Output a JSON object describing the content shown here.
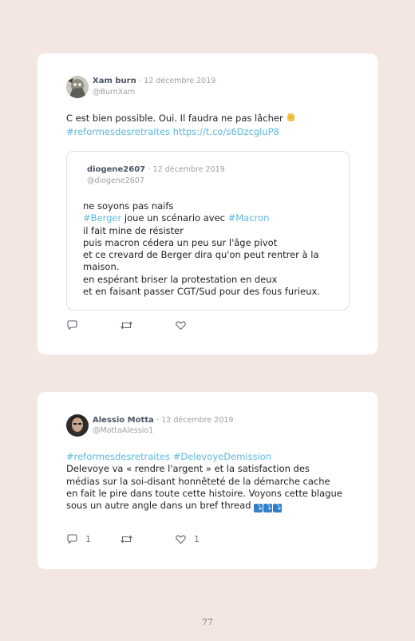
{
  "page": {
    "number": "77"
  },
  "tweets": [
    {
      "author_name": "Xam burn",
      "date": "· 12 décembre 2019",
      "handle": "@BurnXam",
      "text_line1": "C est bien possible. Oui. Il faudra ne pas lâcher",
      "emoji": "raised-fist-icon",
      "hashtag": "#reformesdesretraites",
      "link": "https://t.co/s6DzcgluP8",
      "quoted": {
        "author_name": "diogene2607",
        "date": "· 12 décembre 2019",
        "handle": "@diogene2607",
        "line1": "ne soyons pas naifs",
        "line2_hashtag1": "#Berger",
        "line2_middle": " joue un scénario avec ",
        "line2_hashtag2": "#Macron",
        "line3": "il fait mine de résister",
        "line4": "puis macron cédera un peu sur l'âge pivot",
        "line5": "et ce crevard de Berger dira qu'on peut rentrer à la",
        "line6": "maison.",
        "line7": "en espérant briser la protestation en deux",
        "line8": "et en faisant passer CGT/Sud pour des fous furieux."
      },
      "actions": {
        "reply_count": "",
        "retweet_count": "",
        "like_count": ""
      }
    },
    {
      "author_name": "Alessio Motta",
      "date": "· 12 décembre 2019",
      "handle": "@MottaAlessio1",
      "hashtag1": "#reformesdesretraites",
      "hashtag2": "#DelevoyeDemission",
      "line2": "Delevoye va « rendre l'argent » et la satisfaction des",
      "line3": "médias sur la soi-disant honnêteté de la démarche cache",
      "line4": "en fait le pire dans toute cette histoire. Voyons cette blague",
      "line5": "sous un autre angle dans un bref thread",
      "emoji": "arrow-down-emoji-icon",
      "actions": {
        "reply_count": "1",
        "retweet_count": "",
        "like_count": "1"
      }
    }
  ],
  "colors": {
    "background": "#f4e7e3",
    "card": "#ffffff",
    "link": "#5cb9de",
    "muted": "#9aa0a6"
  }
}
